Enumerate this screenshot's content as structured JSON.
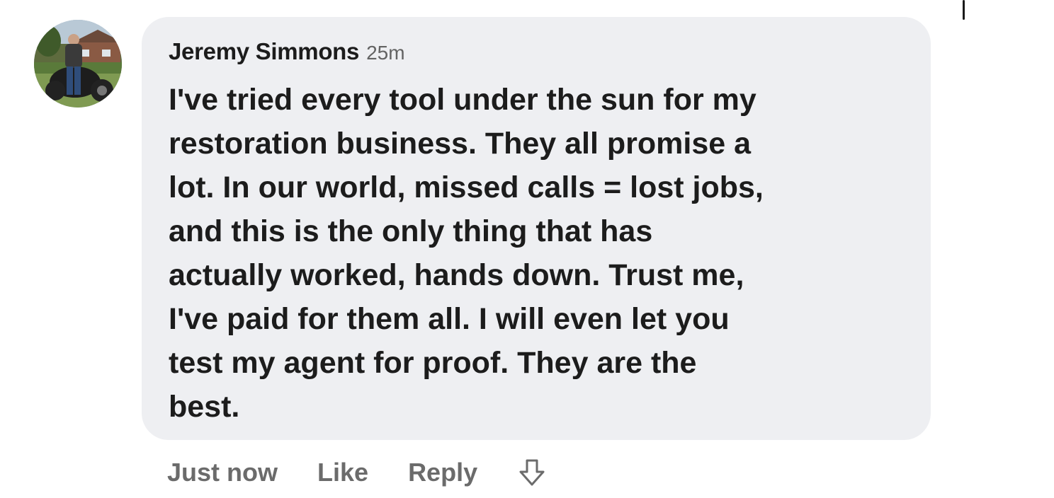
{
  "comment": {
    "author": "Jeremy Simmons",
    "timestamp": "25m",
    "text_lines": [
      "I've tried every tool under the sun for my",
      "restoration business. They all promise a",
      "lot. In our world, missed calls = lost jobs,",
      "and this is the only thing that has",
      "actually worked, hands down. Trust me,",
      "I've paid for them all. I will even let you",
      "test my agent for proof. They are the",
      "best."
    ]
  },
  "actions": {
    "time": "Just now",
    "like_label": "Like",
    "reply_label": "Reply",
    "react_icon": "arrow-down-outline-icon"
  },
  "colors": {
    "bubble_bg": "#eeeff2",
    "text": "#1c1c1c",
    "muted": "#6b6b6b"
  }
}
